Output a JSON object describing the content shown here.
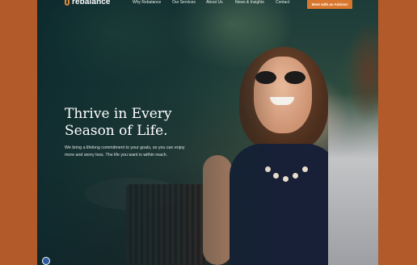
{
  "brand": {
    "name": "rebalance",
    "accent": "#d9772e",
    "frame_color": "#b35a2b"
  },
  "nav": {
    "items": [
      "Why Rebalance",
      "Our Services",
      "About Us",
      "News & Insights",
      "Contact"
    ],
    "cta": "Meet with an Advisor"
  },
  "hero": {
    "title_line1": "Thrive in Every",
    "title_line2": "Season of Life.",
    "body": "We bring a lifelong commitment to your goals, so you can enjoy more and worry less. The life you want is within reach."
  },
  "icons": {
    "logo": "rebalance-logo-icon",
    "chat": "chat-bubble-icon"
  }
}
